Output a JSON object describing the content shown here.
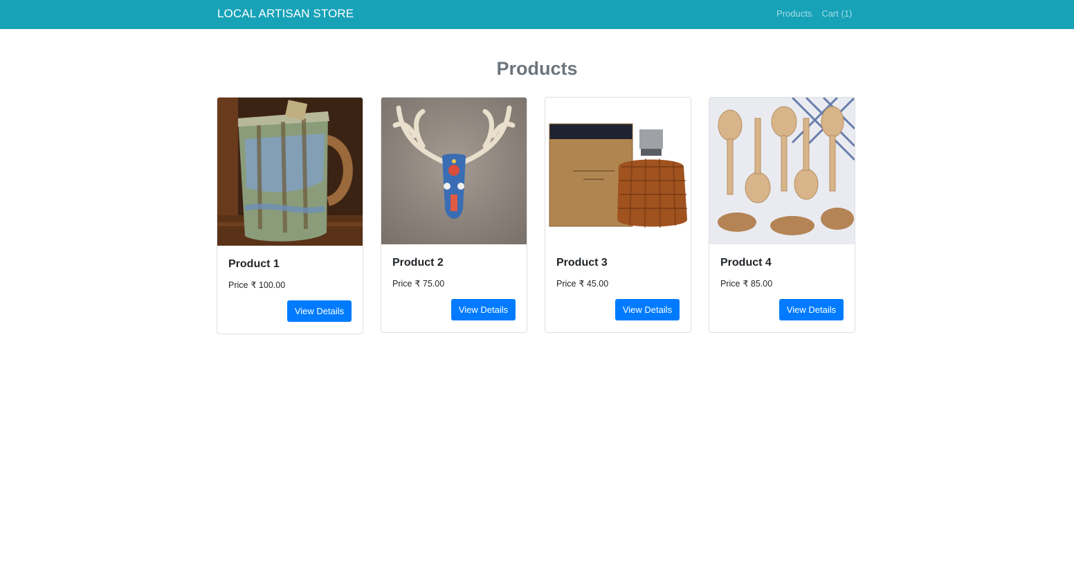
{
  "navbar": {
    "brand": "LOCAL ARTISAN STORE",
    "links": [
      {
        "label": "Products"
      },
      {
        "label": "Cart (1)"
      }
    ]
  },
  "page": {
    "title": "Products"
  },
  "products": [
    {
      "name": "Product 1",
      "price_prefix": "Price",
      "price": "₹ 100.00",
      "button": "View Details",
      "image": "ceramic-pitcher"
    },
    {
      "name": "Product 2",
      "price_prefix": "Price",
      "price": "₹ 75.00",
      "button": "View Details",
      "image": "beaded-antler-skull"
    },
    {
      "name": "Product 3",
      "price_prefix": "Price",
      "price": "₹ 45.00",
      "button": "View Details",
      "image": "perfume-bottle-box"
    },
    {
      "name": "Product 4",
      "price_prefix": "Price",
      "price": "₹ 85.00",
      "button": "View Details",
      "image": "wooden-spoons"
    }
  ],
  "colors": {
    "navbar": "#17a2b8",
    "primary_button": "#007bff",
    "title": "#6c757d"
  }
}
